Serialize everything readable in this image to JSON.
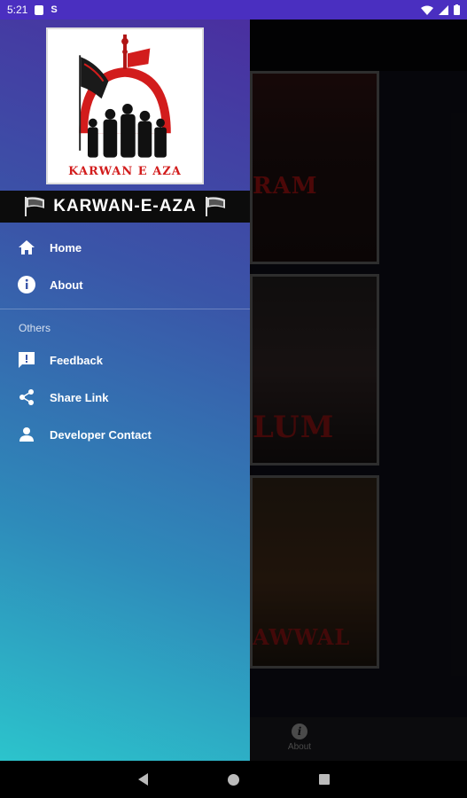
{
  "status_bar": {
    "time": "5:21",
    "s_label": "S",
    "icons": [
      "sim-card-icon",
      "wifi-icon",
      "no-signal-icon",
      "battery-icon"
    ]
  },
  "background_app": {
    "cards": [
      {
        "text": "RAM"
      },
      {
        "text": "LUM"
      },
      {
        "text": "AWWAL"
      }
    ],
    "bottom_nav": {
      "about_label": "About",
      "about_icon": "i"
    }
  },
  "drawer": {
    "logo_caption": "KARWAN E AZA",
    "title": "KARWAN-E-AZA",
    "menu": [
      {
        "label": "Home",
        "icon": "home-icon"
      },
      {
        "label": "About",
        "icon": "info-icon",
        "glyph": "i"
      }
    ],
    "section_title": "Others",
    "others": [
      {
        "label": "Feedback",
        "icon": "feedback-icon",
        "glyph": "!"
      },
      {
        "label": "Share Link",
        "icon": "share-icon"
      },
      {
        "label": "Developer Contact",
        "icon": "person-icon"
      }
    ]
  },
  "colors": {
    "status_bar": "#4a2fc0",
    "drawer_gradient_top": "#4a2fa0",
    "drawer_gradient_bottom": "#2cc4cc",
    "title_bar": "#0c0c0c",
    "logo_red": "#d21c1c"
  }
}
